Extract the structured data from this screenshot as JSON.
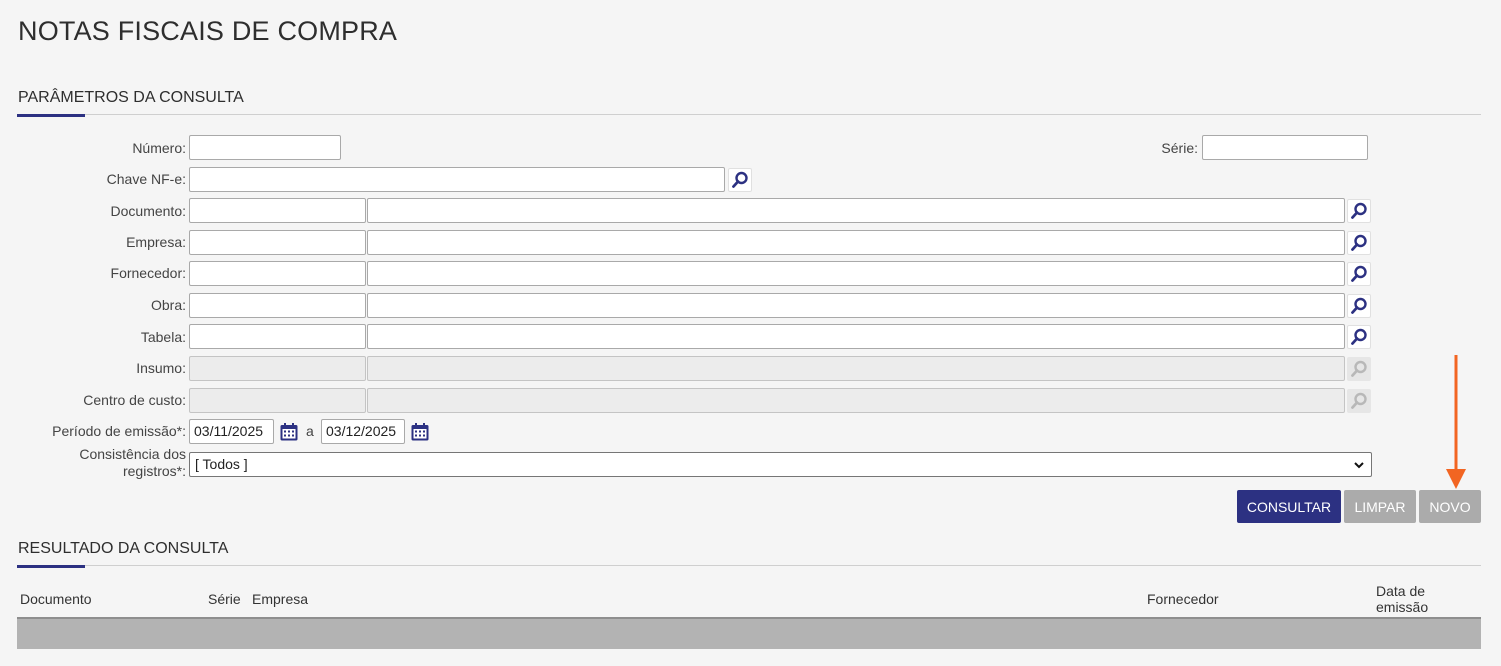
{
  "page": {
    "title": "NOTAS FISCAIS DE COMPRA"
  },
  "params": {
    "section_title": "PARÂMETROS DA CONSULTA",
    "numero_label": "Número:",
    "numero_value": "",
    "serie_label": "Série:",
    "serie_value": "",
    "chave_label": "Chave NF-e:",
    "chave_value": "",
    "rows": [
      {
        "label": "Documento:",
        "code": "",
        "desc": "",
        "enabled": true
      },
      {
        "label": "Empresa:",
        "code": "",
        "desc": "",
        "enabled": true
      },
      {
        "label": "Fornecedor:",
        "code": "",
        "desc": "",
        "enabled": true
      },
      {
        "label": "Obra:",
        "code": "",
        "desc": "",
        "enabled": true
      },
      {
        "label": "Tabela:",
        "code": "",
        "desc": "",
        "enabled": true
      },
      {
        "label": "Insumo:",
        "code": "",
        "desc": "",
        "enabled": false
      },
      {
        "label": "Centro de custo:",
        "code": "",
        "desc": "",
        "enabled": false
      }
    ],
    "periodo_label": "Período de emissão*:",
    "periodo_start": "03/11/2025",
    "periodo_sep": "a",
    "periodo_end": "03/12/2025",
    "consistencia_label_line1": "Consistência dos",
    "consistencia_label_line2": "registros*:",
    "consistencia_value": "[ Todos ]"
  },
  "actions": {
    "consultar": "CONSULTAR",
    "limpar": "LIMPAR",
    "novo": "NOVO"
  },
  "results": {
    "section_title": "RESULTADO DA CONSULTA",
    "columns": {
      "documento": "Documento",
      "serie": "Série",
      "empresa": "Empresa",
      "fornecedor": "Fornecedor",
      "data_line1": "Data de",
      "data_line2": "emissão"
    }
  },
  "colors": {
    "primary": "#2c3182",
    "secondary_button": "#ababab",
    "annotation_arrow": "#f26522"
  },
  "icons": {
    "search": "magnifier-icon",
    "calendar": "calendar-icon",
    "select": "chevron-down-icon"
  }
}
